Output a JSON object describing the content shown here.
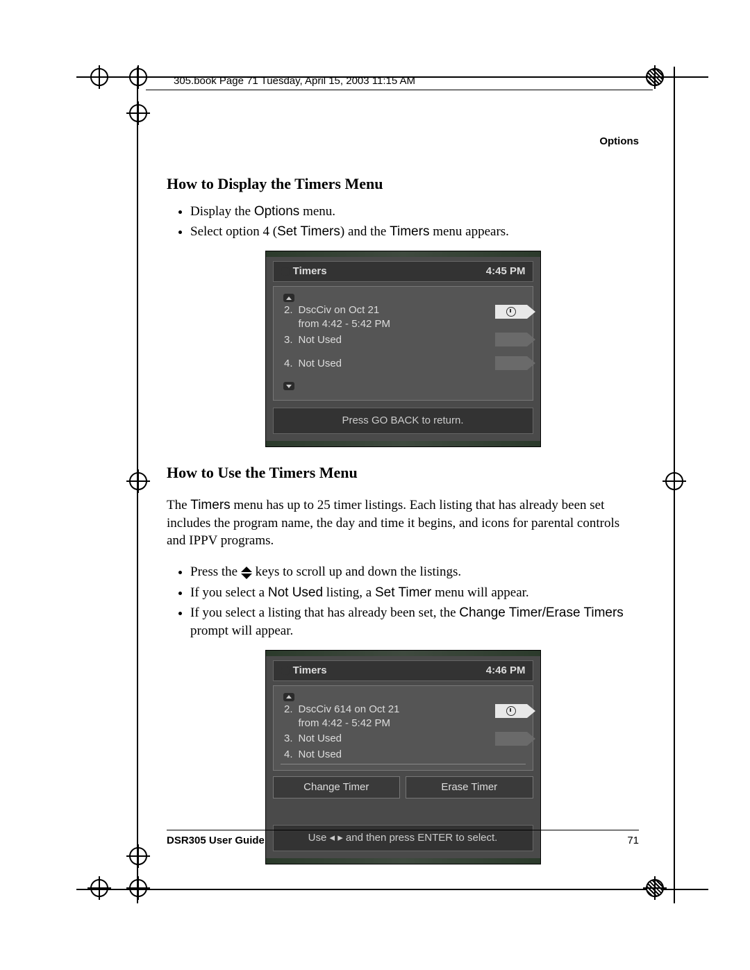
{
  "header_info": "305.book  Page 71  Tuesday, April 15, 2003  11:15 AM",
  "running_head": "Options",
  "section1": {
    "title": "How to Display the Timers Menu",
    "b1_a": "Display the ",
    "b1_b": "Options",
    "b1_c": " menu.",
    "b2_a": "Select option 4 (",
    "b2_b": "Set Timers",
    "b2_c": ") and the ",
    "b2_d": "Timers",
    "b2_e": " menu appears."
  },
  "tv1": {
    "title": "Timers",
    "clock": "4:45 PM",
    "row2a": "DscCiv on Oct 21",
    "row2b": "from 4:42 - 5:42 PM",
    "row3": "Not Used",
    "row4": "Not Used",
    "hint": "Press GO BACK to return."
  },
  "section2": {
    "title": "How to Use the Timers Menu",
    "p_a": "The ",
    "p_b": "Timers",
    "p_c": " menu has up to 25 timer listings. Each listing that has already been set includes the program name, the day and time it begins, and icons for parental controls and IPPV programs.",
    "b1_a": "Press the ",
    "b1_b": " keys to scroll up and down the listings.",
    "b2_a": "If you select a ",
    "b2_b": "Not Used",
    "b2_c": " listing, a ",
    "b2_d": "Set Timer",
    "b2_e": " menu will appear.",
    "b3_a": "If you select a listing that has already been set, the ",
    "b3_b": "Change Timer/Erase Timers",
    "b3_c": " prompt will appear."
  },
  "tv2": {
    "title": "Timers",
    "clock": "4:46 PM",
    "row2a": "DscCiv 614 on Oct 21",
    "row2b": "from 4:42 - 5:42 PM",
    "row3": "Not Used",
    "row4": "Not Used",
    "btn1": "Change Timer",
    "btn2": "Erase Timer",
    "hint": "Use  ◂ ▸  and then press ENTER to select."
  },
  "footer": {
    "guide": "DSR305 User Guide",
    "page": "71"
  }
}
